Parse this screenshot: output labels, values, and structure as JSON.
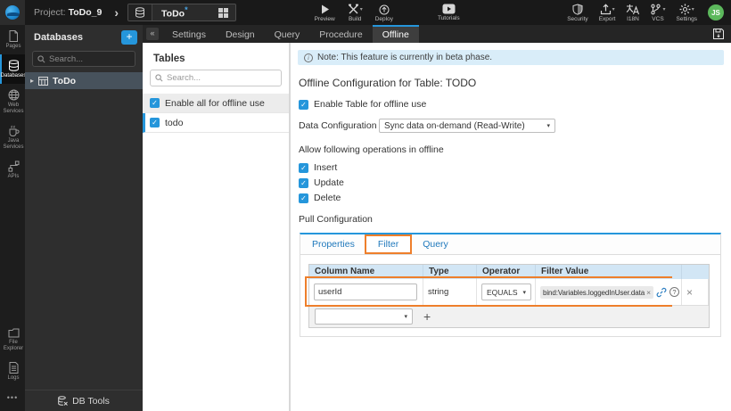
{
  "colors": {
    "accent": "#2596db",
    "annotation": "#ee7f2b",
    "avatar_green": "#5cb85c",
    "note_bg": "#d9edf9",
    "header_row_bg": "#d2e6f5"
  },
  "icons": {
    "caret_down": "▾",
    "collapse": "«",
    "expand": "▸",
    "chevron_right": "›",
    "check": "✓",
    "close": "×",
    "more": "•••",
    "info": "i",
    "help": "?"
  },
  "topbar": {
    "project_label": "Project:",
    "project_name": "ToDo_9",
    "workspace": {
      "name": "ToDo",
      "modified_mark": "*"
    },
    "actions": {
      "preview": "Preview",
      "build": "Build",
      "deploy": "Deploy",
      "tutorials": "Tutorials"
    },
    "right": {
      "security": "Security",
      "export": "Export",
      "i18n": "I18N",
      "vcs": "VCS",
      "settings": "Settings",
      "avatar": "JS"
    }
  },
  "left_rail": {
    "items": [
      {
        "label": "Pages",
        "active": false
      },
      {
        "label": "Databases",
        "active": true
      },
      {
        "label": "Web Services",
        "active": false
      },
      {
        "label": "Java Services",
        "active": false
      },
      {
        "label": "APIs",
        "active": false
      }
    ],
    "bottom_items": [
      {
        "label": "File Explorer"
      },
      {
        "label": "Logs"
      }
    ]
  },
  "db_panel": {
    "title": "Databases",
    "add_button": "+",
    "search_placeholder": "Search...",
    "tree_item": "ToDo",
    "footer": "DB Tools"
  },
  "service_tabs": {
    "tabs": [
      "Settings",
      "Design",
      "Query",
      "Procedure",
      "Offline"
    ],
    "active": "Offline"
  },
  "tables_panel": {
    "title": "Tables",
    "search_placeholder": "Search...",
    "enable_all_label": "Enable all for offline use",
    "rows": [
      {
        "label": "todo",
        "checked": true
      }
    ]
  },
  "main": {
    "note": "Note: This feature is currently in beta phase.",
    "title": "Offline Configuration for Table: TODO",
    "enable_table_label": "Enable Table for offline use",
    "data_configuration": {
      "label": "Data Configuration",
      "value": "Sync data on-demand (Read-Write)"
    },
    "operations_label": "Allow following operations in offline",
    "operations": [
      "Insert",
      "Update",
      "Delete"
    ],
    "pull_configuration_label": "Pull Configuration",
    "pull_tabs": [
      "Properties",
      "Filter",
      "Query"
    ],
    "pull_active_tab": "Filter",
    "filter_table": {
      "headers": [
        "Column Name",
        "Type",
        "Operator",
        "Filter Value"
      ],
      "row": {
        "column_name": "userId",
        "type": "string",
        "operator": "EQUALS",
        "filter_value": "bind:Variables.loggedInUser.data"
      },
      "add_button": "+"
    }
  }
}
